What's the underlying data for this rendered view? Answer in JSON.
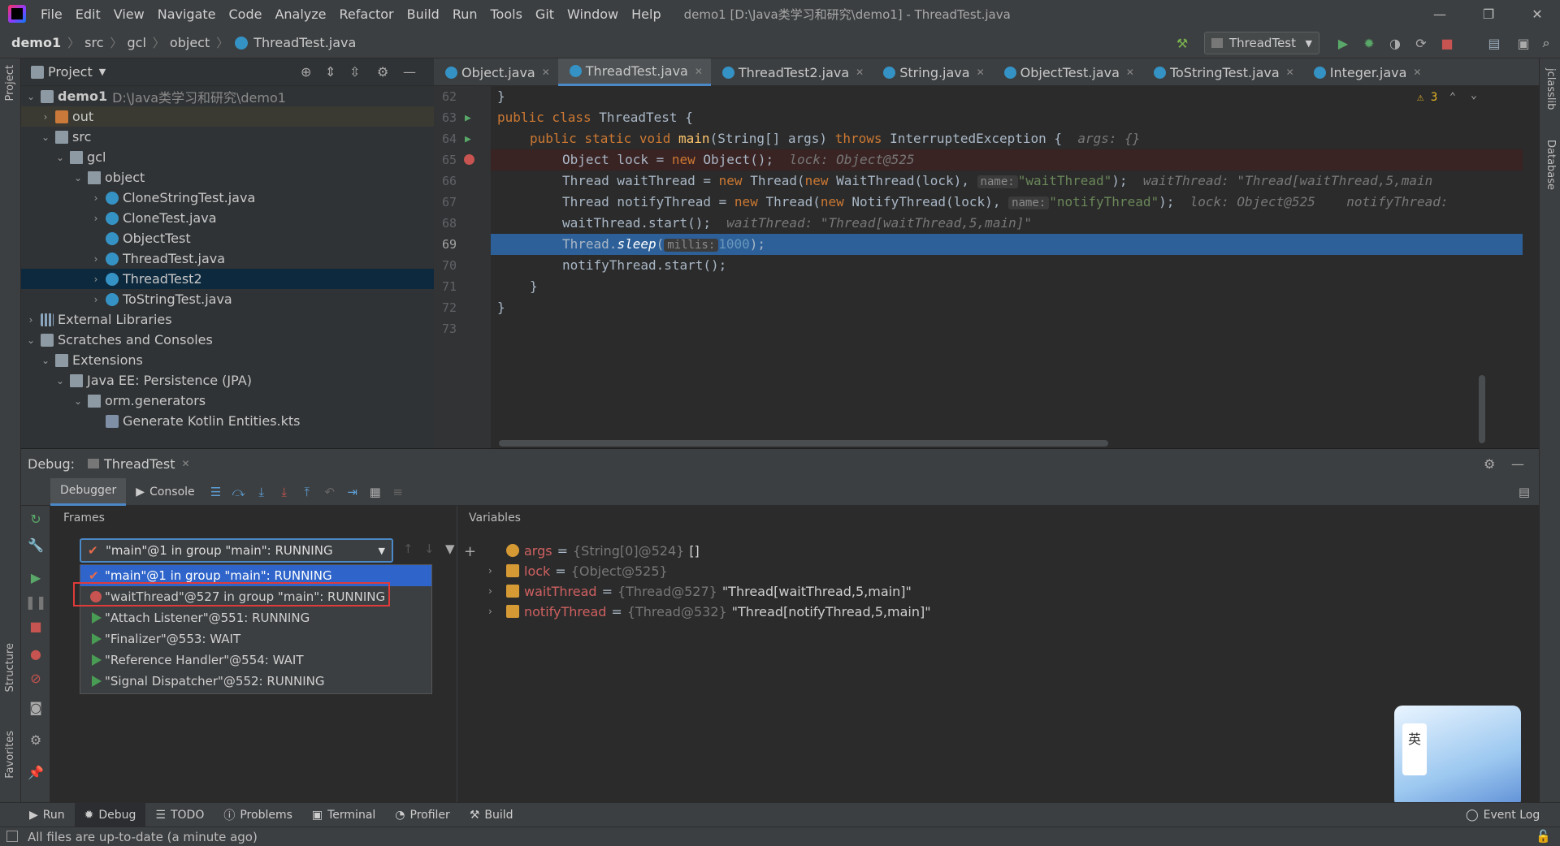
{
  "menubar": {
    "items": [
      "File",
      "Edit",
      "View",
      "Navigate",
      "Code",
      "Analyze",
      "Refactor",
      "Build",
      "Run",
      "Tools",
      "Git",
      "Window",
      "Help"
    ],
    "title": "demo1 [D:\\Java类学习和研究\\demo1] - ThreadTest.java"
  },
  "breadcrumb": [
    "demo1",
    "src",
    "gcl",
    "object",
    "ThreadTest.java"
  ],
  "run_config": "ThreadTest",
  "project": {
    "header": "Project",
    "root": "demo1",
    "root_path": "D:\\Java类学习和研究\\demo1",
    "items": [
      "out",
      "src",
      "gcl",
      "object",
      "CloneStringTest.java",
      "CloneTest.java",
      "ObjectTest",
      "ThreadTest.java",
      "ThreadTest2",
      "ToStringTest.java",
      "External Libraries",
      "Scratches and Consoles",
      "Extensions",
      "Java EE: Persistence (JPA)",
      "orm.generators",
      "Generate Kotlin Entities.kts"
    ]
  },
  "tabs": [
    "Object.java",
    "ThreadTest.java",
    "ThreadTest2.java",
    "String.java",
    "ObjectTest.java",
    "ToStringTest.java",
    "Integer.java"
  ],
  "warnings": "3",
  "code": {
    "line_numbers": [
      "62",
      "63",
      "64",
      "65",
      "66",
      "67",
      "68",
      "69",
      "70",
      "71",
      "72",
      "73"
    ],
    "l62": "}",
    "l63_a": "public class ",
    "l63_b": "ThreadTest {",
    "l64_a": "public static void ",
    "l64_b": "main",
    "l64_c": "(String[] args) ",
    "l64_d": "throws ",
    "l64_e": "InterruptedException {",
    "l64_hint": "args: {}",
    "l65_a": "Object lock = ",
    "l65_b": "new ",
    "l65_c": "Object();",
    "l65_hint": "lock: Object@525",
    "l66_a": "Thread waitThread = ",
    "l66_b": "new ",
    "l66_c": "Thread(",
    "l66_d": "new ",
    "l66_e": "WaitThread(lock), ",
    "l66_ph": "name:",
    "l66_str": "\"waitThread\"",
    "l66_f": ");",
    "l66_hint": "waitThread: \"Thread[waitThread,5,main",
    "l67_a": "Thread notifyThread = ",
    "l67_b": "new ",
    "l67_c": "Thread(",
    "l67_d": "new ",
    "l67_e": "NotifyThread(lock), ",
    "l67_ph": "name:",
    "l67_str": "\"notifyThread\"",
    "l67_f": ");",
    "l67_hint": "lock: Object@525    notifyThread:",
    "l68_a": "waitThread.start();",
    "l68_hint": "waitThread: \"Thread[waitThread,5,main]\"",
    "l69_a": "Thread.",
    "l69_b": "sleep",
    "l69_c": "(",
    "l69_ph": "millis:",
    "l69_num": "1000",
    "l69_d": ");",
    "l70_a": "notifyThread.start();",
    "l71": "}",
    "l72": "}"
  },
  "debug": {
    "label": "Debug:",
    "session": "ThreadTest",
    "tabs": [
      "Debugger",
      "Console"
    ],
    "frames_label": "Frames",
    "variables_label": "Variables",
    "thread_selected": "\"main\"@1 in group \"main\": RUNNING",
    "threads": [
      "\"main\"@1 in group \"main\": RUNNING",
      "\"waitThread\"@527 in group \"main\": RUNNING",
      "\"Attach Listener\"@551: RUNNING",
      "\"Finalizer\"@553: WAIT",
      "\"Reference Handler\"@554: WAIT",
      "\"Signal Dispatcher\"@552: RUNNING"
    ],
    "variables": [
      {
        "name": "args",
        "type": "{String[0]@524}",
        "value": "[]"
      },
      {
        "name": "lock",
        "type": "{Object@525}",
        "value": ""
      },
      {
        "name": "waitThread",
        "type": "{Thread@527}",
        "value": "\"Thread[waitThread,5,main]\""
      },
      {
        "name": "notifyThread",
        "type": "{Thread@532}",
        "value": "\"Thread[notifyThread,5,main]\""
      }
    ]
  },
  "bottom_tabs": [
    "Run",
    "Debug",
    "TODO",
    "Problems",
    "Terminal",
    "Profiler",
    "Build"
  ],
  "event_log": "Event Log",
  "status": "All files are up-to-date (a minute ago)",
  "side": {
    "project": "Project",
    "structure": "Structure",
    "favorites": "Favorites",
    "jclasslib": "jclasslib",
    "database": "Database"
  },
  "ime": "英"
}
